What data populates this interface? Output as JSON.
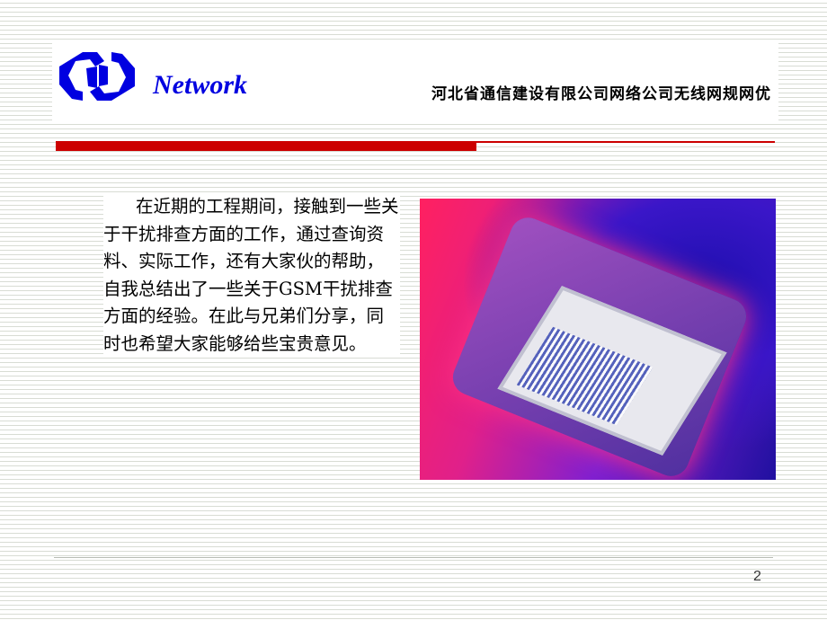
{
  "header": {
    "brand": "Network",
    "company": "河北省通信建设有限公司网络公司无线网规网优",
    "accent_color": "#cc0000",
    "brand_color": "#0000e0"
  },
  "content": {
    "paragraph": "在近期的工程期间，接触到一些关于干扰排查方面的工作，通过查询资料、实际工作，还有大家伙的帮助，自我总结出了一些关于GSM干扰排查方面的经验。在此与兄弟们分享，同时也希望大家能够给些宝贵意见。"
  },
  "footer": {
    "page_number": "2"
  }
}
